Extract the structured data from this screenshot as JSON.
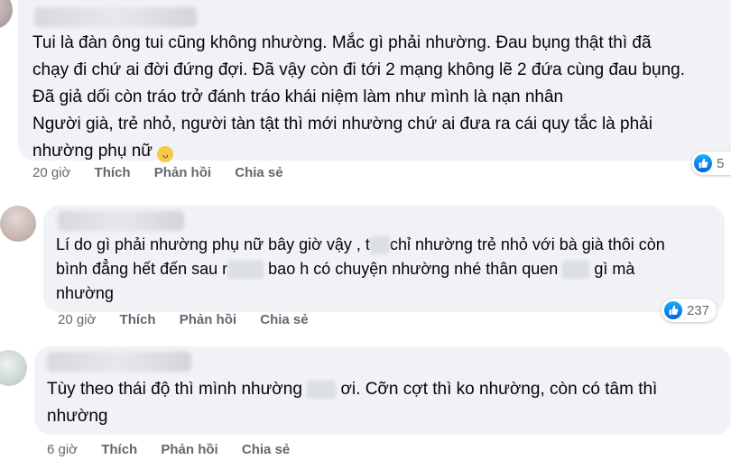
{
  "comments": [
    {
      "lines": [
        "Tui là đàn ông tui cũng không nhường. Mắc gì phải nhường. Đau bụng thật thì đã",
        "chạy đi chứ ai đời đứng đợi. Đã vậy còn đi tới 2 mạng không lẽ 2 đứa cùng đau bụng.",
        "Đã giả dối còn tráo trở đánh tráo khái niệm làm như mình là nạn nhân",
        "Người già, trẻ nhỏ, người tàn tật thì mới nhường chứ ai đưa ra cái quy tắc là phải",
        "nhường phụ nữ"
      ],
      "emoji": "unamused-face",
      "time": "20 giờ",
      "like": "Thích",
      "reply": "Phản hồi",
      "share": "Chia sẻ",
      "reactions": "5"
    },
    {
      "line1a": "Lí do gì phải nhường phụ nữ bây giờ vậy , t",
      "line1b": "chỉ nhường trẻ nhỏ với bà già thôi còn",
      "line2a": "bình đẳng hết đến sau r",
      "line2b": "bao h có chuyện nhường nhé thân quen",
      "line2c": "gì mà",
      "line3": "nhường",
      "time": "20 giờ",
      "like": "Thích",
      "reply": "Phản hồi",
      "share": "Chia sẻ",
      "reactions": "237"
    },
    {
      "line1a": "Tùy theo thái độ thì mình nhường",
      "line1b": "ơi. Cỡn cợt thì ko nhường, còn có tâm thì",
      "line2": "nhường",
      "time": "6 giờ",
      "like": "Thích",
      "reply": "Phản hồi",
      "share": "Chia sẻ"
    }
  ],
  "colors": {
    "bubble": "#f0f2f5",
    "meta": "#65676b",
    "like_blue": "#0866ff"
  }
}
